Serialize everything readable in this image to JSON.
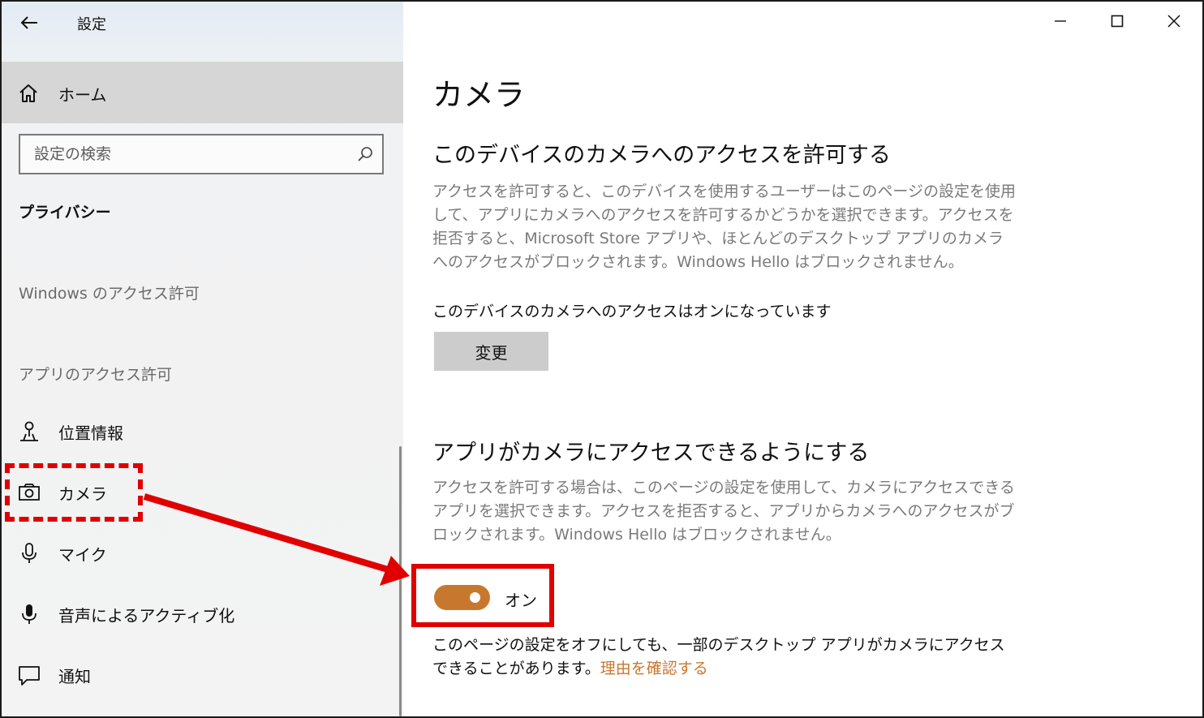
{
  "window": {
    "title": "設定"
  },
  "sidebar": {
    "home_label": "ホーム",
    "search_placeholder": "設定の検索",
    "section_title": "プライバシー",
    "group_windows": "Windows のアクセス許可",
    "group_apps": "アプリのアクセス許可",
    "items": [
      {
        "label": "位置情報",
        "icon": "location-icon"
      },
      {
        "label": "カメラ",
        "icon": "camera-icon",
        "selected": true
      },
      {
        "label": "マイク",
        "icon": "microphone-icon"
      },
      {
        "label": "音声によるアクティブ化",
        "icon": "voice-activation-icon"
      },
      {
        "label": "通知",
        "icon": "notification-icon"
      }
    ]
  },
  "main": {
    "page_title": "カメラ",
    "device_section": {
      "heading": "このデバイスのカメラへのアクセスを許可する",
      "description": "アクセスを許可すると、このデバイスを使用するユーザーはこのページの設定を使用して、アプリにカメラへのアクセスを許可するかどうかを選択できます。アクセスを拒否すると、Microsoft Store アプリや、ほとんどのデスクトップ アプリのカメラへのアクセスがブロックされます。Windows Hello はブロックされません。",
      "status": "このデバイスのカメラへのアクセスはオンになっています",
      "change_button": "変更"
    },
    "app_section": {
      "heading": "アプリがカメラにアクセスできるようにする",
      "description": "アクセスを許可する場合は、このページの設定を使用して、カメラにアクセスできるアプリを選択できます。アクセスを拒否すると、アプリからカメラへのアクセスがブロックされます。Windows Hello はブロックされません。",
      "toggle_state": "オン",
      "toggle_on": true
    },
    "footnote": {
      "text": "このページの設定をオフにしても、一部のデスクトップ アプリがカメラにアクセスできることがあります。",
      "link": "理由を確認する"
    }
  },
  "colors": {
    "accent": "#c8782e",
    "annotation": "#e00000",
    "home_bg": "#d6d6d6",
    "button_bg": "#cccccc"
  }
}
